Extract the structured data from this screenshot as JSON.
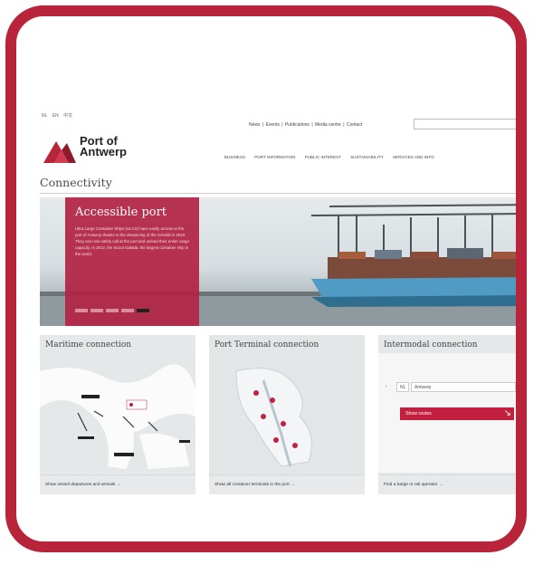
{
  "site": {
    "logo_text": "Port of\nAntwerp",
    "logo_line1": "Port of",
    "logo_line2": "Antwerp",
    "brand_color": "#b8243a"
  },
  "languages": [
    "NL",
    "EN",
    "中文"
  ],
  "top_links": [
    "News",
    "Events",
    "Publications",
    "Media centre",
    "Contact"
  ],
  "search": {
    "placeholder": "",
    "icon": "search-icon"
  },
  "nav": [
    "BUSINESS",
    "PORT INFORMATION",
    "PUBLIC INTEREST",
    "SUSTAINABILITY",
    "SERVICES AND INFO"
  ],
  "page_title": "Connectivity",
  "hero": {
    "title": "Accessible port",
    "text": "Ultra Large Container Ships (ULCS) have easily access to the port of Antwerp thanks to the deepening of the Scheldt in 2010. They can now safely call at the port and unload their entire cargo capacity. In 2012, the Scoot Galatta, the largest container ship in the world.",
    "slides": 5,
    "active_slide": 5
  },
  "tiles": [
    {
      "title": "Maritime connection",
      "footer": "Show vessel departures and arrivals →"
    },
    {
      "title": "Port Terminal connection",
      "footer": "Show all container terminals in the port →"
    },
    {
      "title": "Intermodal connection",
      "footer": "Find a barge or rail operator →",
      "form": {
        "from": "Antwerp",
        "to": "",
        "mode": "NL",
        "button": "Show routes"
      }
    }
  ]
}
